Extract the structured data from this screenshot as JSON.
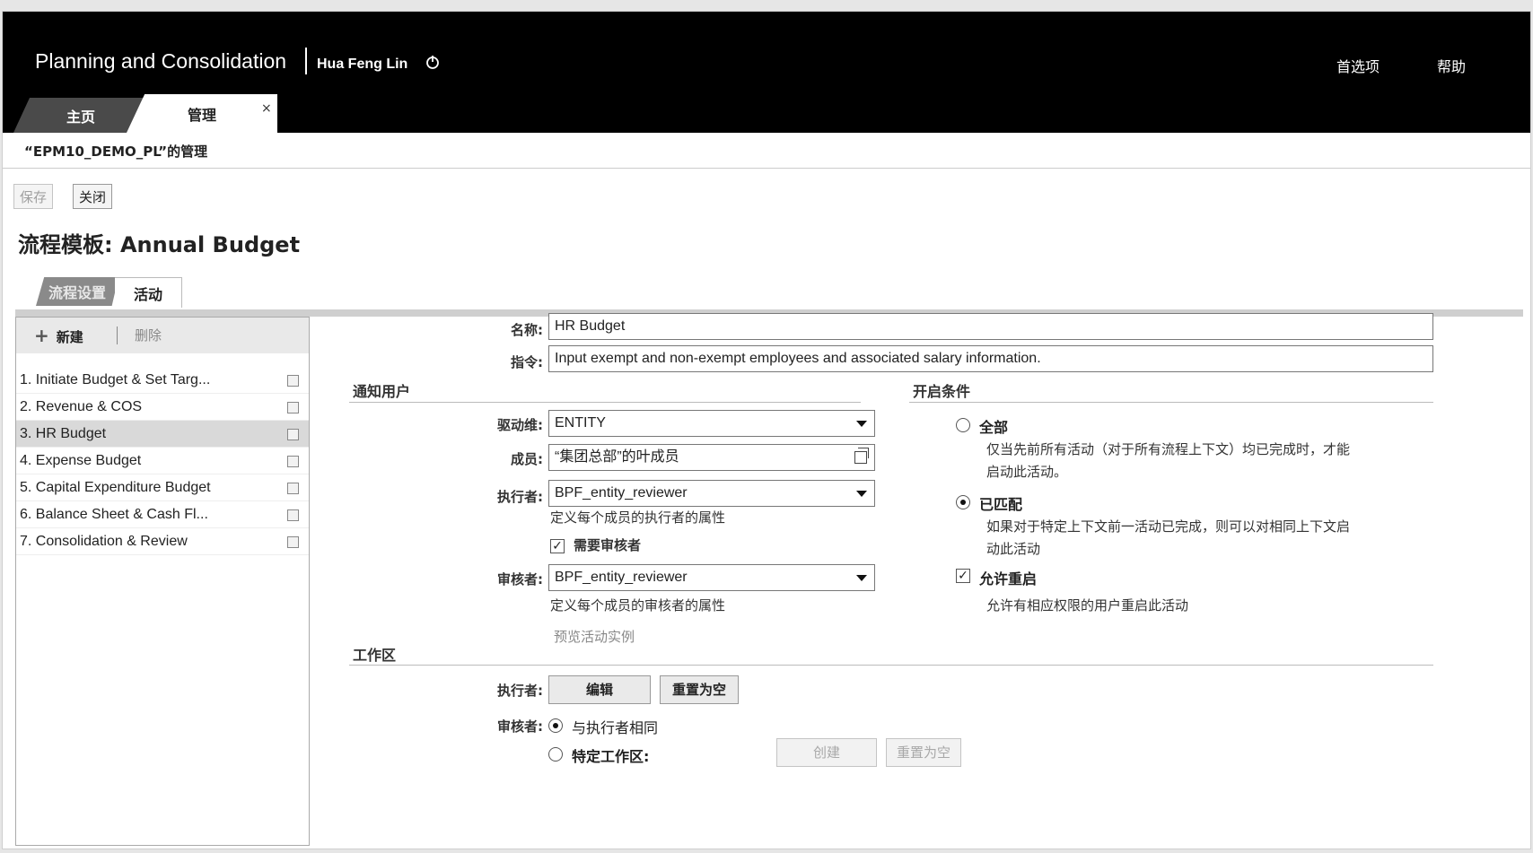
{
  "app": {
    "title": "Planning and Consolidation",
    "user": "Hua Feng Lin"
  },
  "topnav": {
    "preferences": "首选项",
    "help": "帮助"
  },
  "tabs": [
    {
      "label": "主页"
    },
    {
      "label": "管理",
      "close": "×"
    }
  ],
  "breadcrumb": "“EPM10_DEMO_PL”的管理",
  "toolbar": {
    "save": "保存",
    "close": "关闭"
  },
  "process": {
    "title": "流程模板: Annual Budget"
  },
  "subtabs": [
    {
      "label": "流程设置"
    },
    {
      "label": "活动"
    }
  ],
  "activities_toolbar": {
    "new": "新建",
    "new_icon": "+",
    "delete": "删除"
  },
  "activities": [
    {
      "label": "1. Initiate Budget & Set Targ..."
    },
    {
      "label": "2. Revenue & COS"
    },
    {
      "label": "3. HR Budget"
    },
    {
      "label": "4. Expense Budget"
    },
    {
      "label": "5. Capital Expenditure Budget"
    },
    {
      "label": "6. Balance Sheet & Cash Fl..."
    },
    {
      "label": "7. Consolidation & Review"
    }
  ],
  "form": {
    "name_label": "名称:",
    "name_value": "HR Budget",
    "instr_label": "指令:",
    "instr_value": "Input exempt and non-exempt employees and associated salary information.",
    "notify_section": "通知用户",
    "driver_label": "驱动维:",
    "driver_value": "ENTITY",
    "member_label": "成员:",
    "member_value": "“集团总部”的叶成员",
    "performer_label": "执行者:",
    "performer_value": "BPF_entity_reviewer",
    "performer_note": "定义每个成员的执行者的属性",
    "require_reviewer": "需要审核者",
    "reviewer_label": "审核者:",
    "reviewer_value": "BPF_entity_reviewer",
    "reviewer_note": "定义每个成员的审核者的属性",
    "preview_link": "预览活动实例",
    "open_section": "开启条件",
    "opt_all": "全部",
    "opt_all_desc1": "仅当先前所有活动（对于所有流程上下文）均已完成时，才能",
    "opt_all_desc2": "启动此活动。",
    "opt_matched": "已匹配",
    "opt_matched_desc1": "如果对于特定上下文前一活动已完成，则可以对相同上下文启",
    "opt_matched_desc2": "动此活动",
    "allow_reopen": "允许重启",
    "allow_reopen_desc": "允许有相应权限的用户重启此活动",
    "workspace_section": "工作区",
    "ws_performer_label": "执行者:",
    "ws_edit": "编辑",
    "ws_reset": "重置为空",
    "ws_reviewer_label": "审核者:",
    "ws_same": "与执行者相同",
    "ws_specific": "特定工作区:",
    "ws_create": "创建",
    "ws_reset2": "重置为空"
  }
}
